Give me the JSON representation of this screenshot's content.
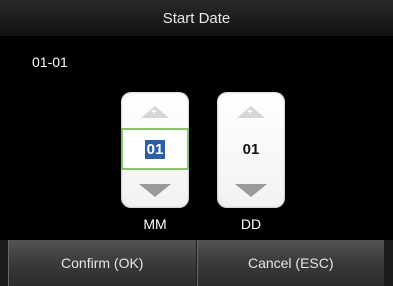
{
  "title": "Start Date",
  "current_value": "01-01",
  "month": {
    "value": "01",
    "label": "MM",
    "selected": true
  },
  "day": {
    "value": "01",
    "label": "DD",
    "selected": false
  },
  "buttons": {
    "confirm": "Confirm (OK)",
    "cancel": "Cancel (ESC)"
  },
  "colors": {
    "selection_border": "#8ac26b",
    "selection_fill": "#2b5fa8"
  },
  "icons": {
    "increment": "up-arrow-plus-icon",
    "decrement": "down-arrow-icon"
  }
}
